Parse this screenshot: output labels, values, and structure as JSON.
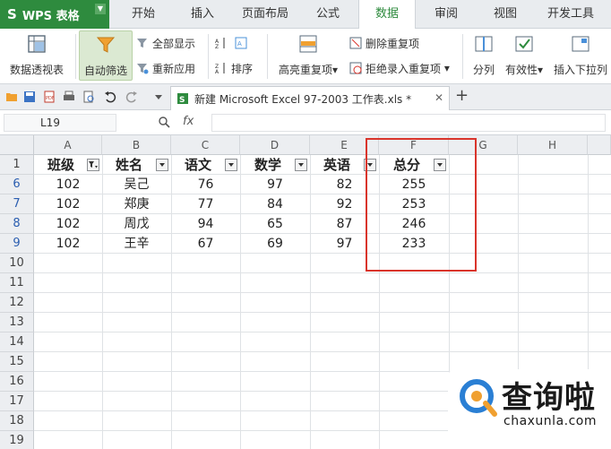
{
  "app": {
    "name": "WPS 表格",
    "logo": "S"
  },
  "menu_tabs": [
    "开始",
    "插入",
    "页面布局",
    "公式",
    "数据",
    "审阅",
    "视图",
    "开发工具"
  ],
  "active_tab": "数据",
  "ribbon": {
    "pivot_table": "数据透视表",
    "auto_filter": "自动筛选",
    "show_all": "全部显示",
    "reapply": "重新应用",
    "sort": "排序",
    "highlight_duplicates": "高亮重复项",
    "delete_duplicates": "删除重复项",
    "reject_duplicates": "拒绝录入重复项",
    "split_column": "分列",
    "validation": "有效性",
    "insert_dropdown": "插入下拉列"
  },
  "document_tab": {
    "title": "新建 Microsoft Excel 97-2003 工作表.xls *",
    "add": "+"
  },
  "formula_bar": {
    "name_box": "L19",
    "fx": "fx",
    "formula": ""
  },
  "columns": [
    "A",
    "B",
    "C",
    "D",
    "E",
    "F",
    "G",
    "H"
  ],
  "rows": [
    "1",
    "6",
    "7",
    "8",
    "9",
    "10",
    "11",
    "12",
    "13",
    "14",
    "15",
    "16",
    "17",
    "18",
    "19"
  ],
  "table": {
    "headers": [
      "班级",
      "姓名",
      "语文",
      "数学",
      "英语",
      "总分"
    ],
    "data": [
      [
        "102",
        "吴己",
        "76",
        "97",
        "82",
        "255"
      ],
      [
        "102",
        "郑庚",
        "77",
        "84",
        "92",
        "253"
      ],
      [
        "102",
        "周戊",
        "94",
        "65",
        "87",
        "246"
      ],
      [
        "102",
        "王辛",
        "67",
        "69",
        "97",
        "233"
      ]
    ]
  },
  "watermark": {
    "cn": "查询啦",
    "url": "chaxunla.com"
  },
  "colors": {
    "accent": "#2e8b3e",
    "highlight_box": "#d9342b",
    "filtered_row": "#2a5db0"
  }
}
